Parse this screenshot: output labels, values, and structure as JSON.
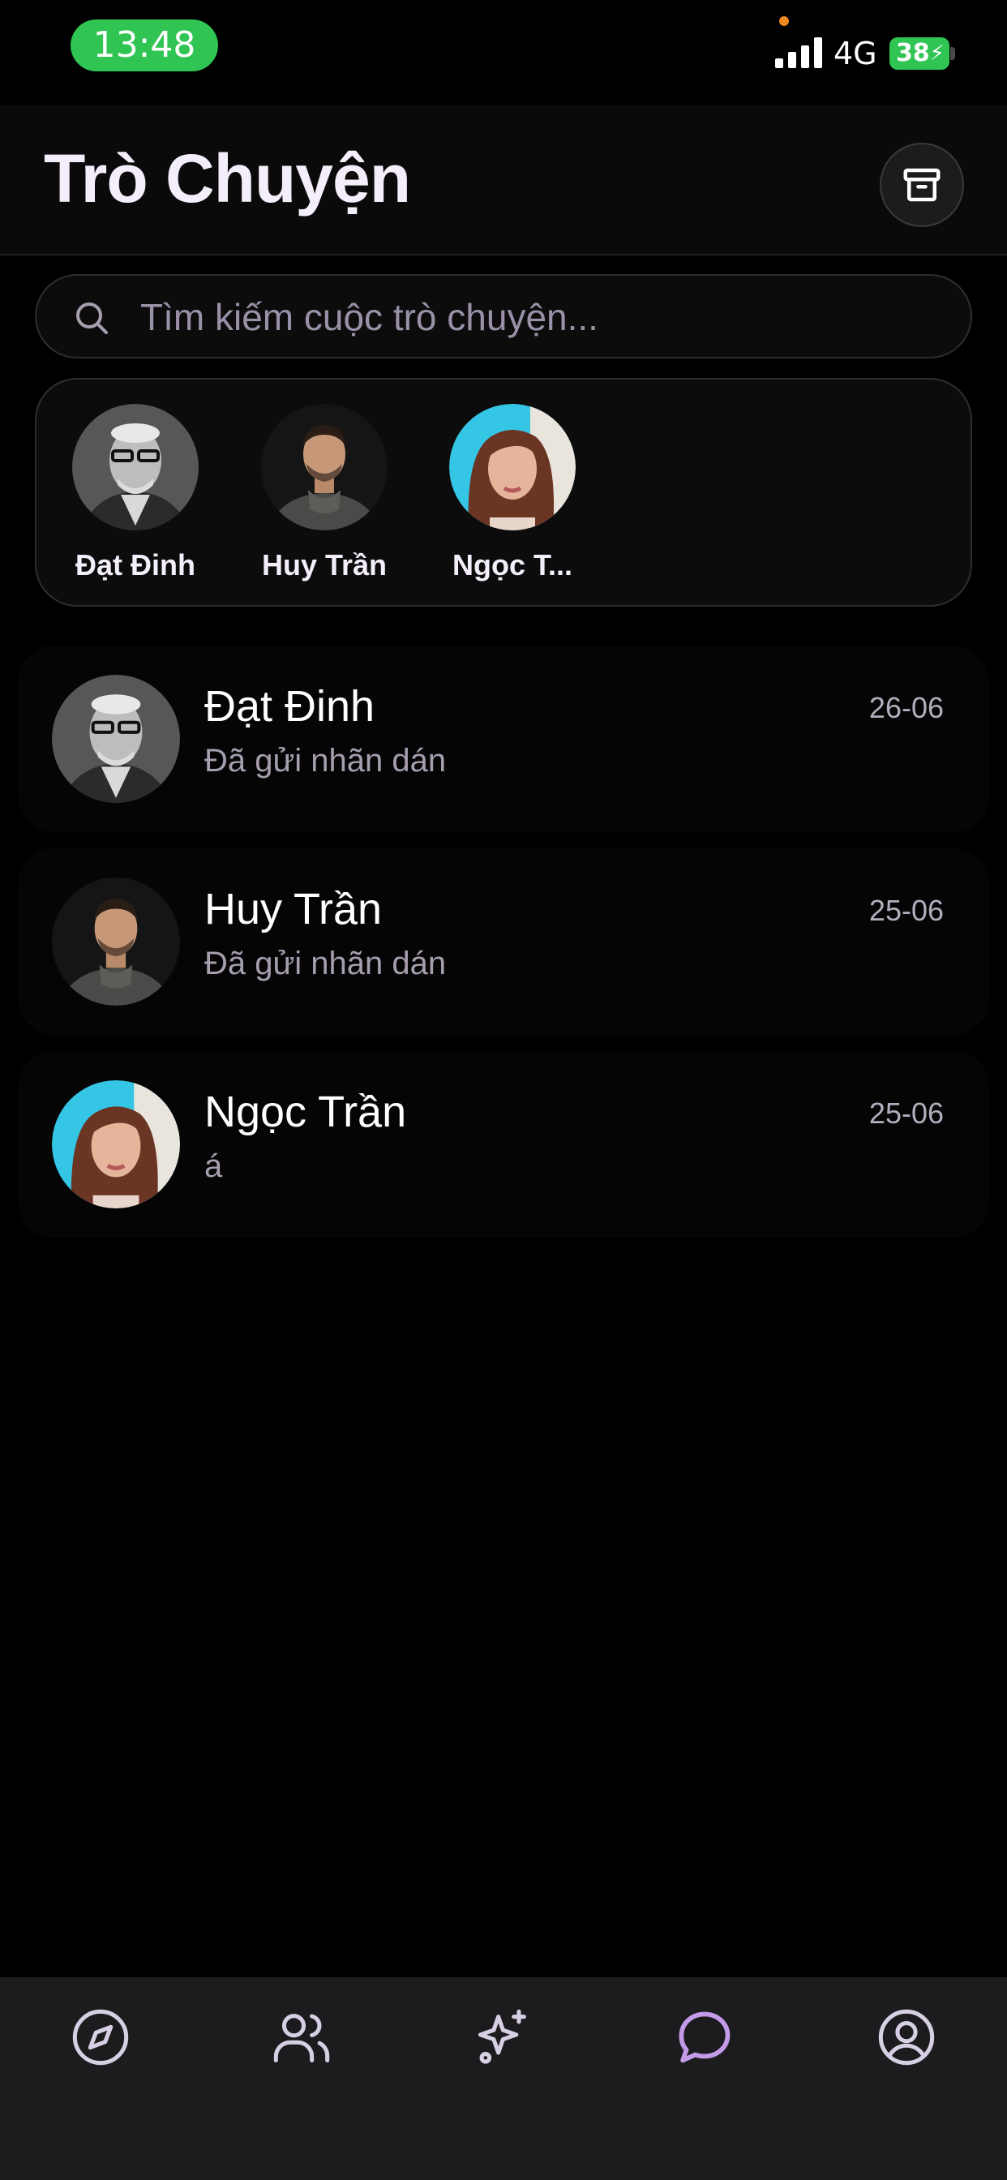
{
  "status_bar": {
    "time": "13:48",
    "network": "4G",
    "battery": "38",
    "signal_icon": "cellular-signal-icon",
    "battery_icon": "battery-charging-icon"
  },
  "header": {
    "title": "Trò Chuyện",
    "archive_icon": "archive-box-icon"
  },
  "search": {
    "placeholder": "Tìm kiếm cuộc trò chuyện...",
    "value": "",
    "icon": "search-icon"
  },
  "stories": [
    {
      "name": "Đạt Đinh"
    },
    {
      "name": "Huy Trần"
    },
    {
      "name": "Ngọc T..."
    }
  ],
  "conversations": [
    {
      "name": "Đạt Đinh",
      "preview": "Đã gửi nhãn dán",
      "date": "26-06"
    },
    {
      "name": "Huy Trần",
      "preview": "Đã gửi nhãn dán",
      "date": "25-06"
    },
    {
      "name": "Ngọc Trần",
      "preview": "á",
      "date": "25-06"
    }
  ],
  "bottom_nav": {
    "items": [
      {
        "icon": "compass-icon",
        "active": false
      },
      {
        "icon": "users-icon",
        "active": false
      },
      {
        "icon": "sparkles-icon",
        "active": false
      },
      {
        "icon": "chat-bubble-icon",
        "active": true
      },
      {
        "icon": "profile-icon",
        "active": false
      }
    ]
  },
  "colors": {
    "background": "#000000",
    "accent_purple": "#c39be8",
    "nav_icon": "#d7cfe4",
    "time_pill": "#30c453",
    "battery": "#30c453"
  }
}
